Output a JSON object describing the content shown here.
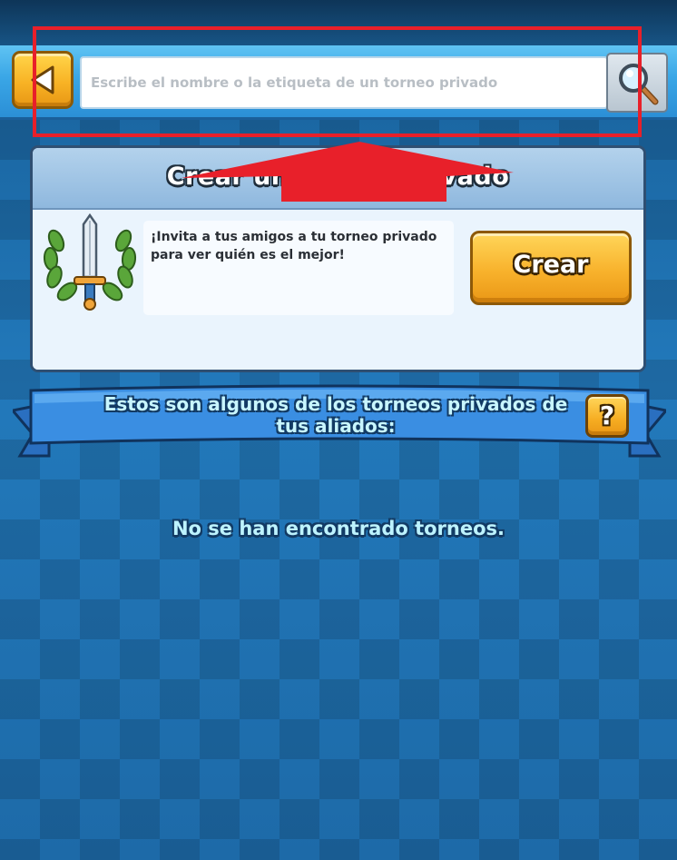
{
  "header": {
    "search_placeholder": "Escribe el nombre o la etiqueta de un torneo privado"
  },
  "icons": {
    "back": "back-arrow-icon",
    "search": "magnifying-glass-icon",
    "emblem": "sword-laurel-icon",
    "help": "question-mark-icon"
  },
  "create_panel": {
    "title": "Crear un torneo privado",
    "invite_text": "¡Invita a tus amigos a tu torneo privado para ver quién es el mejor!",
    "create_label": "Crear"
  },
  "allies_banner": {
    "text": "Estos son algunos de los torneos privados de tus aliados:",
    "help_label": "?"
  },
  "empty_state": {
    "message": "No se han encontrado torneos."
  },
  "colors": {
    "accent_yellow": "#f8b325",
    "highlight_red": "#e8202a",
    "background_blue": "#1e6fae"
  }
}
